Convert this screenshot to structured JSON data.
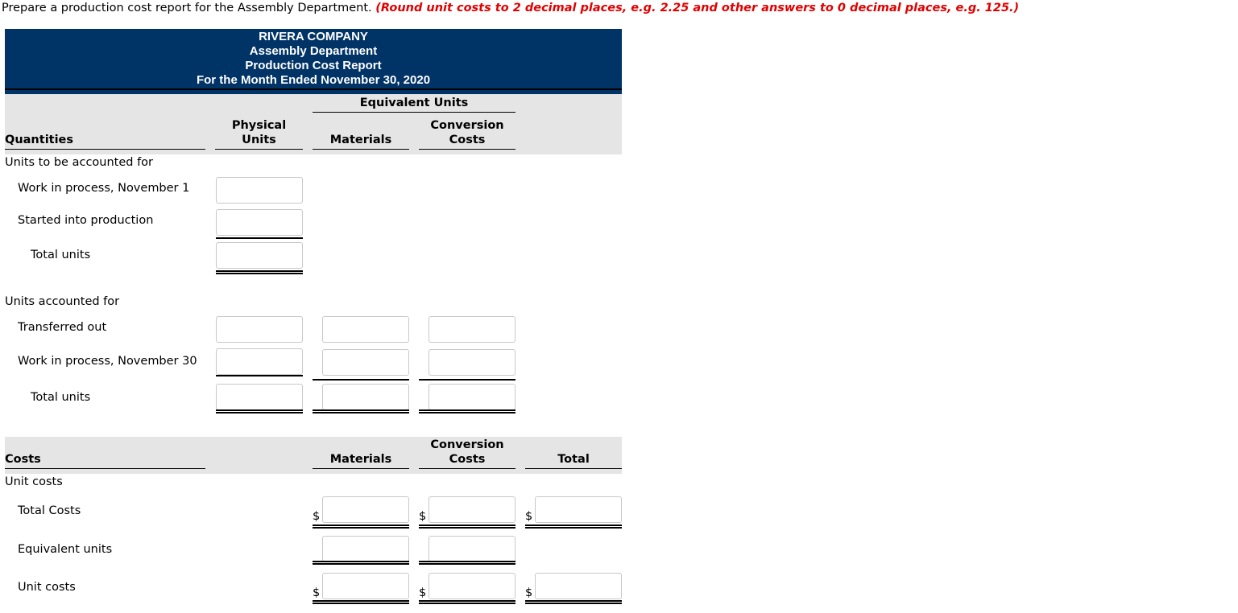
{
  "instructions": {
    "text": "Prepare a production cost report for the Assembly Department.",
    "note": "(Round unit costs to 2 decimal places, e.g. 2.25 and other answers to 0 decimal places, e.g. 125.)"
  },
  "report": {
    "company": "RIVERA COMPANY",
    "department": "Assembly Department",
    "title": "Production Cost Report",
    "period": "For the Month Ended November 30, 2020"
  },
  "colors": {
    "banner": "#003366",
    "header_band": "#e5e5e5",
    "note": "#e00000"
  },
  "quantities": {
    "header": {
      "section": "Quantities",
      "physical": [
        "Physical",
        "Units"
      ],
      "equivalent_units": "Equivalent Units",
      "materials": "Materials",
      "conversion": [
        "Conversion",
        "Costs"
      ]
    },
    "to_account_for": {
      "label": "Units to be accounted for",
      "rows": [
        {
          "label": "Work in process, November 1",
          "physical": ""
        },
        {
          "label": "Started into production",
          "physical": ""
        },
        {
          "label": "Total units",
          "physical": ""
        }
      ]
    },
    "accounted_for": {
      "label": "Units accounted for",
      "rows": [
        {
          "label": "Transferred out",
          "physical": "",
          "materials": "",
          "conversion": ""
        },
        {
          "label": "Work in process, November 30",
          "physical": "",
          "materials": "",
          "conversion": ""
        },
        {
          "label": "Total units",
          "physical": "",
          "materials": "",
          "conversion": ""
        }
      ]
    }
  },
  "costs": {
    "header": {
      "section": "Costs",
      "materials": "Materials",
      "conversion": [
        "Conversion",
        "Costs"
      ],
      "total": "Total"
    },
    "unit_costs": {
      "label": "Unit costs",
      "currency_symbol": "$",
      "rows": [
        {
          "label": "Total Costs",
          "materials": "",
          "conversion": "",
          "total": ""
        },
        {
          "label": "Equivalent units",
          "materials": "",
          "conversion": ""
        },
        {
          "label": "Unit costs",
          "materials": "",
          "conversion": "",
          "total": ""
        }
      ]
    }
  }
}
